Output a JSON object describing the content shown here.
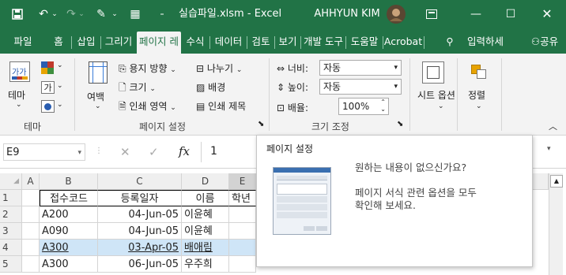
{
  "title": {
    "filename": "실습파일.xlsm",
    "separator": "-",
    "app": "Excel",
    "user": "AHHYUN KIM"
  },
  "tabs": [
    "파일",
    "홈",
    "삽입",
    "그리기",
    "페이지 레",
    "수식",
    "데이터",
    "검토",
    "보기",
    "개발 도구",
    "도움말",
    "Acrobat"
  ],
  "tell_me": "입력하세",
  "share": "공유",
  "ribbon": {
    "theme_label": "테마",
    "theme_icon_text": "가가",
    "theme_group": "테마",
    "margin_label": "여백",
    "orientation_label": "용지 방향",
    "size_label": "크기",
    "print_area_label": "인쇄 영역",
    "breaks_label": "나누기",
    "background_label": "배경",
    "print_titles_label": "인쇄 제목",
    "page_setup_group": "페이지 설정",
    "width_label": "너비:",
    "width_value": "자동",
    "height_label": "높이:",
    "height_value": "자동",
    "scale_label": "배율:",
    "scale_value": "100%",
    "scale_group": "크기 조정",
    "sheet_options_label": "시트 옵션",
    "arrange_label": "정렬"
  },
  "formula_bar": {
    "name_box": "E9",
    "value": "1"
  },
  "columns": [
    "A",
    "B",
    "C",
    "D",
    "E"
  ],
  "rows": [
    {
      "num": "1",
      "b": "접수코드",
      "c": "등록일자",
      "d": "이름",
      "e": "학년"
    },
    {
      "num": "2",
      "b": "A200",
      "c": "04-Jun-05",
      "d": "이윤혜",
      "e": ""
    },
    {
      "num": "3",
      "b": "A090",
      "c": "04-Jun-05",
      "d": "이윤혜",
      "e": ""
    },
    {
      "num": "4",
      "b": "A300",
      "c": "03-Apr-05",
      "d": "배애림",
      "e": ""
    },
    {
      "num": "5",
      "b": "A300",
      "c": "06-Jun-05",
      "d": "우주희",
      "e": ""
    }
  ],
  "tooltip": {
    "title": "페이지 설정",
    "line1": "원하는 내용이 없으신가요?",
    "line2": "페이지 서식 관련 옵션을 모두",
    "line3": "확인해 보세요."
  }
}
